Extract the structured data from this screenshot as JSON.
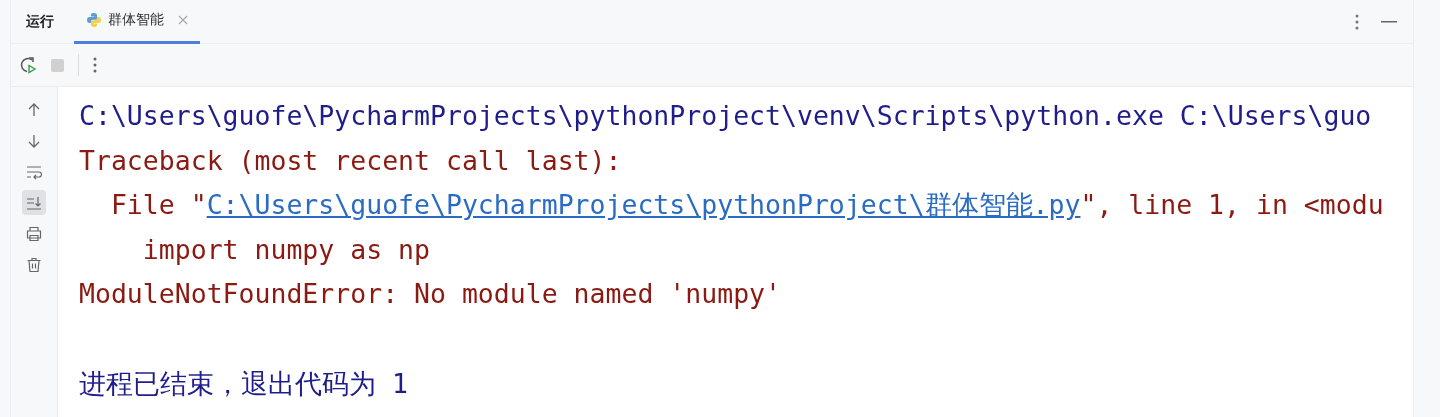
{
  "panel": {
    "title": "运行"
  },
  "tabs": [
    {
      "label": "群体智能",
      "selected": true
    }
  ],
  "toolbar": {
    "stop_disabled": true
  },
  "gutter": [
    {
      "kind": "up",
      "on": false
    },
    {
      "kind": "down",
      "on": false
    },
    {
      "kind": "wrap",
      "on": false
    },
    {
      "kind": "scroll",
      "on": true
    },
    {
      "kind": "print",
      "on": false
    },
    {
      "kind": "trash",
      "on": false
    }
  ],
  "console": [
    {
      "kind": "command",
      "text": "C:\\Users\\guofe\\PycharmProjects\\pythonProject\\venv\\Scripts\\python.exe C:\\Users\\guo"
    },
    {
      "kind": "error",
      "text": "Traceback (most recent call last):"
    },
    {
      "kind": "file",
      "before": "  File \"",
      "link": "C:\\Users\\guofe\\PycharmProjects\\pythonProject\\群体智能.py",
      "after": "\", line 1, in <modu"
    },
    {
      "kind": "code",
      "text": "    import numpy as np"
    },
    {
      "kind": "error",
      "text": "ModuleNotFoundError: No module named 'numpy'"
    },
    {
      "kind": "exit",
      "text": "进程已结束，退出代码为 1"
    }
  ]
}
